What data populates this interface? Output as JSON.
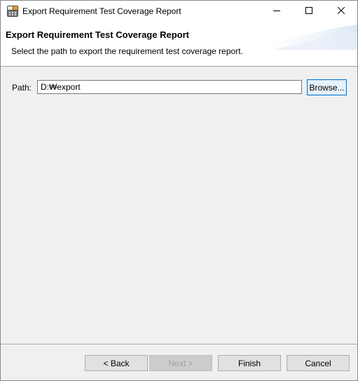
{
  "window": {
    "title": "Export Requirement Test Coverage Report",
    "controls": {
      "minimize_icon": "minimize-icon",
      "maximize_icon": "maximize-icon",
      "close_icon": "close-icon"
    }
  },
  "banner": {
    "title": "Export Requirement Test Coverage Report",
    "description": "Select the path to export the requirement test coverage report."
  },
  "form": {
    "path_label": "Path:",
    "path_value": "D:₩export",
    "browse_label": "Browse..."
  },
  "footer": {
    "back_label": "< Back",
    "next_label": "Next >",
    "finish_label": "Finish",
    "cancel_label": "Cancel"
  },
  "colors": {
    "focus_border": "#0078d7",
    "window_bg": "#f0f0f0"
  }
}
